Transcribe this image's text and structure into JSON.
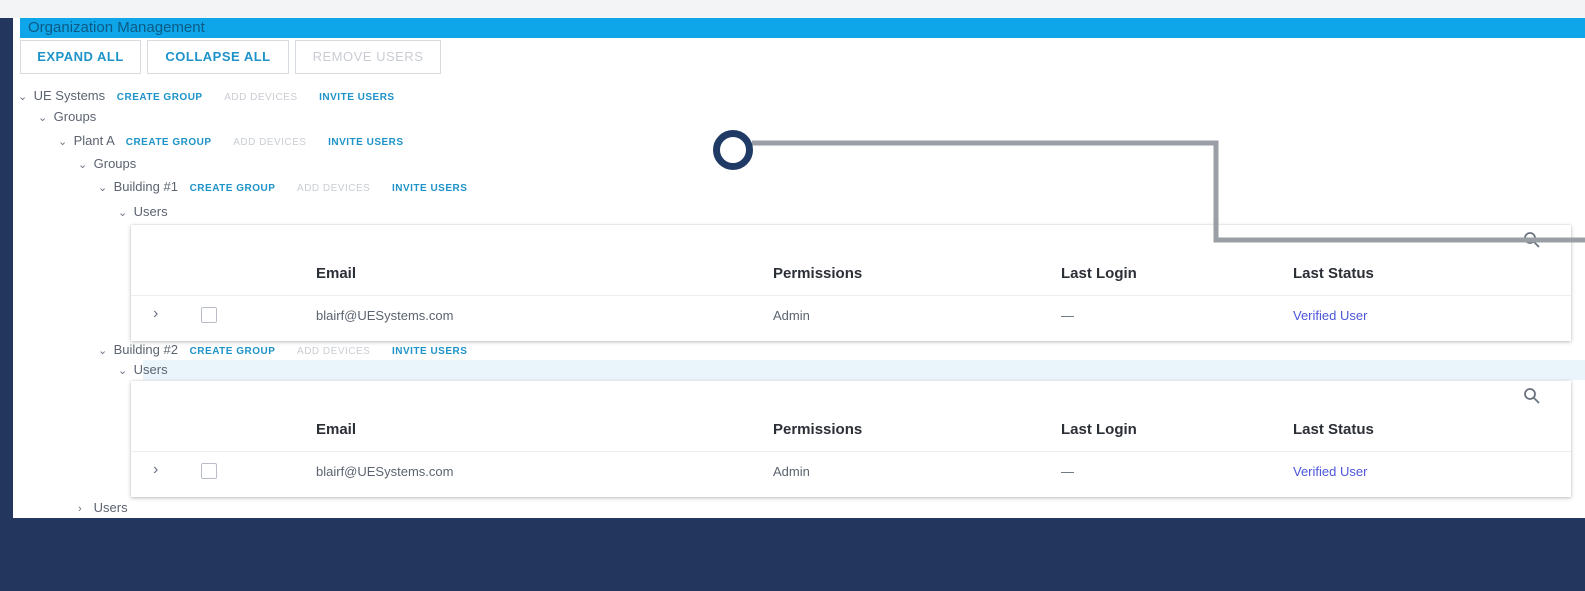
{
  "title": "Organization Management",
  "toolbar": {
    "expand_all": "EXPAND ALL",
    "collapse_all": "COLLAPSE ALL",
    "remove_users": "REMOVE USERS"
  },
  "actions": {
    "create_group": "CREATE GROUP",
    "add_devices": "ADD DEVICES",
    "invite_users": "INVITE USERS"
  },
  "tree": {
    "root": "UE Systems",
    "groups": "Groups",
    "plant": "Plant A",
    "building1": "Building #1",
    "building2": "Building #2",
    "users": "Users"
  },
  "table": {
    "columns": [
      "Email",
      "Permissions",
      "Last Login",
      "Last Status"
    ],
    "rows": [
      {
        "email": "blairf@UESystems.com",
        "permissions": "Admin",
        "last_login": "—",
        "status": "Verified User"
      },
      {
        "email": "blairf@UESystems.com",
        "permissions": "Admin",
        "last_login": "—",
        "status": "Verified User"
      }
    ]
  },
  "colors": {
    "title_bar": "#0ea5e9",
    "accent": "#1d93c9",
    "background": "#23365e",
    "callout": "#1f3a64",
    "status_link": "#4c56d8"
  }
}
